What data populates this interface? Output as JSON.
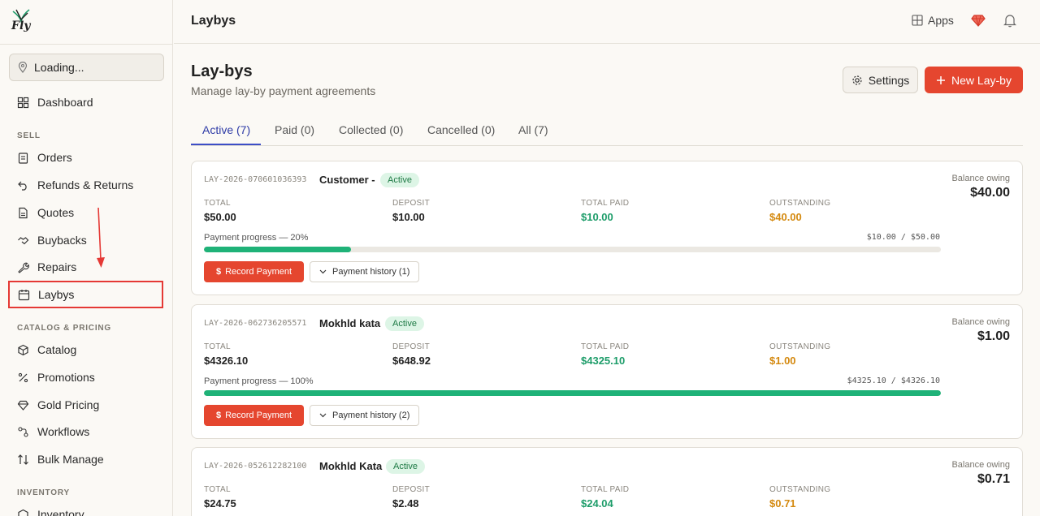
{
  "brand": {
    "logo_text": "Fly"
  },
  "sidebar": {
    "location": "Loading...",
    "dashboard": "Dashboard",
    "sections": {
      "sell": "SELL",
      "catalog": "CATALOG & PRICING",
      "inventory": "INVENTORY"
    },
    "sell_items": [
      "Orders",
      "Refunds & Returns",
      "Quotes",
      "Buybacks",
      "Repairs",
      "Laybys"
    ],
    "catalog_items": [
      "Catalog",
      "Promotions",
      "Gold Pricing",
      "Workflows",
      "Bulk Manage"
    ],
    "inventory_items": [
      "Inventory"
    ],
    "active_item": "Laybys",
    "highlight_color": "#e53935"
  },
  "header": {
    "title": "Laybys",
    "apps_label": "Apps"
  },
  "page": {
    "title": "Lay-bys",
    "subtitle": "Manage lay-by payment agreements",
    "settings_label": "Settings",
    "new_label": "New Lay-by"
  },
  "tabs": [
    "Active (7)",
    "Paid (0)",
    "Collected (0)",
    "Cancelled (0)",
    "All (7)"
  ],
  "labels": {
    "total": "TOTAL",
    "deposit": "DEPOSIT",
    "total_paid": "TOTAL PAID",
    "outstanding": "OUTSTANDING",
    "balance_owing": "Balance owing",
    "record_payment": "Record Payment"
  },
  "cards": [
    {
      "ref": "LAY-2026-070601036393",
      "customer": "Customer -",
      "status": "Active",
      "balance": "$40.00",
      "total": "$50.00",
      "deposit": "$10.00",
      "total_paid": "$10.00",
      "outstanding": "$40.00",
      "progress_label": "Payment progress — 20%",
      "progress_amount": "$10.00 / $50.00",
      "progress": 0.2,
      "history_label": "Payment history (1)"
    },
    {
      "ref": "LAY-2026-062736205571",
      "customer": "Mokhld kata",
      "status": "Active",
      "balance": "$1.00",
      "total": "$4326.10",
      "deposit": "$648.92",
      "total_paid": "$4325.10",
      "outstanding": "$1.00",
      "progress_label": "Payment progress — 100%",
      "progress_amount": "$4325.10 / $4326.10",
      "progress": 1.0,
      "history_label": "Payment history (2)"
    },
    {
      "ref": "LAY-2026-052612282100",
      "customer": "Mokhld Kata",
      "status": "Active",
      "balance": "$0.71",
      "total": "$24.75",
      "deposit": "$2.48",
      "total_paid": "$24.04",
      "outstanding": "$0.71"
    }
  ],
  "colors": {
    "accent": "#e5462f",
    "tab_active": "#3d4ec7",
    "paid_green": "#1e9d6a",
    "outstanding_amber": "#d4890f",
    "progress_fill": "#1fb278"
  }
}
